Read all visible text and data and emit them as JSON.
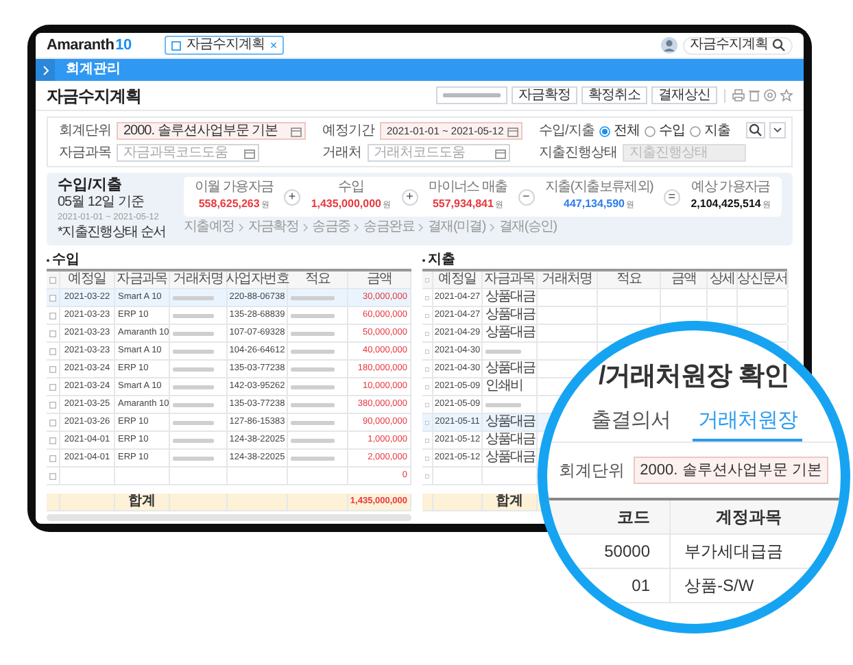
{
  "topbar": {
    "logo": "Amaranth",
    "logo_number": "10",
    "tab": {
      "label": "자금수지계획",
      "close": "×",
      "selected": true
    },
    "search": {
      "value": "자금수지계획"
    }
  },
  "menu_bar": {
    "title": "회계관리"
  },
  "page": {
    "title": "자금수지계획",
    "buttons": [
      "자금확정",
      "확정취소",
      "결재상신"
    ]
  },
  "filters": [
    {
      "kind": "select",
      "label": "회계단위",
      "value": "2000. 솔루션사업부문 기본"
    },
    {
      "kind": "date",
      "label": "예정기간",
      "value": "2021-01-01 ~ 2021-05-12"
    },
    {
      "kind": "radio",
      "label": "수입/지출",
      "options": [
        {
          "label": "전체",
          "selected": true
        },
        {
          "label": "수입",
          "selected": false
        },
        {
          "label": "지출",
          "selected": false
        }
      ]
    },
    {
      "kind": "code",
      "label": "자금과목",
      "placeholder": "자금과목코드도움"
    },
    {
      "kind": "code",
      "label": "거래처",
      "placeholder": "거래처코드도움"
    },
    {
      "kind": "status",
      "label": "지출진행상태",
      "placeholder": "지출진행상태",
      "disabled": true
    }
  ],
  "summary": {
    "title": "수입/지출",
    "date": "05월 12일 기준",
    "period": "2021-01-01 ~ 2021-05-12",
    "note": "*지출진행상태 순서",
    "items": [
      {
        "label": "이월 가용자금",
        "value": "558,625,263",
        "unit": "원",
        "color": "#e8383d"
      },
      {
        "label": "수입",
        "value": "1,435,000,000",
        "unit": "원",
        "color": "#e8383d"
      },
      {
        "label": "마이너스 매출",
        "value": "557,934,841",
        "unit": "원",
        "color": "#e8383d"
      },
      {
        "label": "지출(지출보류제외)",
        "value": "447,134,590",
        "unit": "원",
        "color": "#2b7de9"
      },
      {
        "label": "예상 가용자금",
        "value": "2,104,425,514",
        "unit": "원",
        "color": "#111111"
      }
    ],
    "operators": [
      "+",
      "+",
      "−",
      "="
    ],
    "steps": [
      "지출예정",
      "자금확정",
      "송금중",
      "송금완료",
      "결재(미결)",
      "결재(승인)"
    ]
  },
  "income": {
    "title": "수입",
    "columns": [
      "예정일",
      "자금과목",
      "거래처명",
      "사업자번호",
      "적요",
      "금액"
    ],
    "rows": [
      {
        "date": "2021-03-22",
        "account": "Smart A 10",
        "biz_no": "220-88-06738",
        "amount": "30,000,000",
        "selected": true
      },
      {
        "date": "2021-03-23",
        "account": "ERP 10",
        "biz_no": "135-28-68839",
        "amount": "60,000,000",
        "selected": false
      },
      {
        "date": "2021-03-23",
        "account": "Amaranth 10",
        "biz_no": "107-07-69328",
        "amount": "50,000,000",
        "selected": false
      },
      {
        "date": "2021-03-23",
        "account": "Smart A 10",
        "biz_no": "104-26-64612",
        "amount": "40,000,000",
        "selected": false
      },
      {
        "date": "2021-03-24",
        "account": "ERP 10",
        "biz_no": "135-03-77238",
        "amount": "180,000,000",
        "selected": false
      },
      {
        "date": "2021-03-24",
        "account": "Smart A 10",
        "biz_no": "142-03-95262",
        "amount": "10,000,000",
        "selected": false
      },
      {
        "date": "2021-03-25",
        "account": "Amaranth 10",
        "biz_no": "135-03-77238",
        "amount": "380,000,000",
        "selected": false
      },
      {
        "date": "2021-03-26",
        "account": "ERP 10",
        "biz_no": "127-86-15383",
        "amount": "90,000,000",
        "selected": false
      },
      {
        "date": "2021-04-01",
        "account": "ERP 10",
        "biz_no": "124-38-22025",
        "amount": "1,000,000",
        "selected": false
      },
      {
        "date": "2021-04-01",
        "account": "ERP 10",
        "biz_no": "124-38-22025",
        "amount": "2,000,000",
        "selected": false
      }
    ],
    "header_checked": false,
    "empty_row_checked": false,
    "empty_row_amount": "0",
    "total_label": "합계",
    "total": "1,435,000,000"
  },
  "expense": {
    "title": "지출",
    "columns": [
      "예정일",
      "자금과목",
      "거래처명",
      "적요",
      "금액",
      "상세",
      "상신문서"
    ],
    "rows": [
      {
        "date": "2021-04-27",
        "account": "상품대금",
        "selected": false
      },
      {
        "date": "2021-04-27",
        "account": "상품대금",
        "selected": false
      },
      {
        "date": "2021-04-29",
        "account": "상품대금",
        "selected": false
      },
      {
        "date": "2021-04-30",
        "selected": false
      },
      {
        "date": "2021-04-30",
        "account": "상품대금",
        "selected": false
      },
      {
        "date": "2021-05-09",
        "account": "인쇄비",
        "selected": false
      },
      {
        "date": "2021-05-09",
        "selected": false
      },
      {
        "date": "2021-05-11",
        "account": "상품대금",
        "selected": true
      },
      {
        "date": "2021-05-12",
        "account": "상품대금",
        "selected": false
      },
      {
        "date": "2021-05-12",
        "account": "상품대금",
        "selected": false
      }
    ],
    "header_checked": false,
    "empty_row_checked": false,
    "total_label": "합계"
  },
  "magnifier": {
    "title": "/거래처원장 확인",
    "tabs": [
      {
        "label": "출결의서",
        "selected": false
      },
      {
        "label": "거래처원장",
        "selected": true
      }
    ],
    "field": {
      "label": "회계단위",
      "value": "2000. 솔루션사업부문 기본"
    },
    "columns": [
      "코드",
      "계정과목"
    ],
    "rows": [
      {
        "code": "50000",
        "account": "부가세대급금"
      },
      {
        "code": "01",
        "account": "상품-S/W"
      }
    ]
  }
}
